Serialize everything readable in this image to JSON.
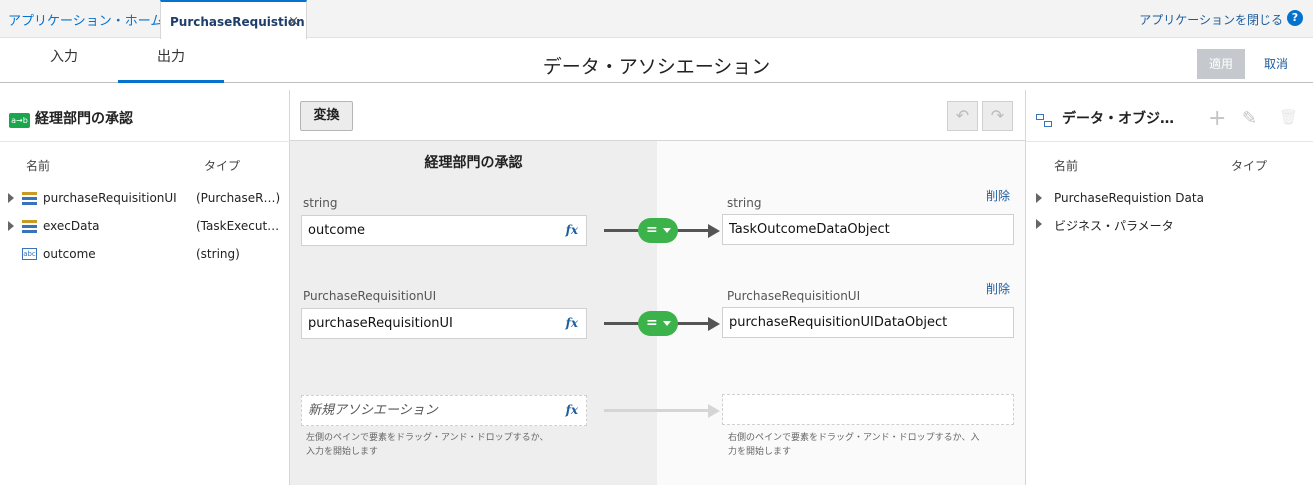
{
  "topbar": {
    "home_tab": "アプリケーション・ホーム",
    "active_tab": "PurchaseRequistion",
    "close_symbol": "×",
    "close_app": "アプリケーションを閉じる",
    "help": "?"
  },
  "header": {
    "tab_input": "入力",
    "tab_output": "出力",
    "title": "データ・アソシエーション",
    "apply": "適用",
    "cancel": "取消"
  },
  "left": {
    "title": "経理部門の承認",
    "icon_text": "a→b",
    "col_name": "名前",
    "col_type": "タイプ",
    "items": [
      {
        "label": "purchaseRequisitionUI",
        "type": "(PurchaseR…)",
        "icon": "list-icon",
        "expandable": true
      },
      {
        "label": "execData",
        "type": "(TaskExecut…)",
        "icon": "list-icon",
        "expandable": true
      },
      {
        "label": "outcome",
        "type": "(string)",
        "icon": "abc-icon",
        "expandable": false
      }
    ]
  },
  "middle": {
    "transform": "変換",
    "undo_icon": "↶",
    "redo_icon": "↷",
    "source_title": "経理部門の承認",
    "fx": "fx",
    "eq": "=",
    "delete": "削除",
    "mappings": [
      {
        "source_type": "string",
        "source_value": "outcome",
        "target_type": "string",
        "target_value": "TaskOutcomeDataObject"
      },
      {
        "source_type": "PurchaseRequisitionUI",
        "source_value": "purchaseRequisitionUI",
        "target_type": "PurchaseRequisitionUI",
        "target_value": "purchaseRequisitionUIDataObject"
      }
    ],
    "new_association": "新規アソシエーション",
    "hint_left_1": "左側のペインで要素をドラッグ・アンド・ドロップするか、",
    "hint_left_2": "入力を開始します",
    "hint_right_1": "右側のペインで要素をドラッグ・アンド・ドロップするか、入",
    "hint_right_2": "力を開始します"
  },
  "right": {
    "title": "データ・オブジ…",
    "add_icon": "+",
    "edit_icon": "✎",
    "delete_icon": "🗑",
    "col_name": "名前",
    "col_type": "タイプ",
    "items": [
      {
        "label": "PurchaseRequistion Data"
      },
      {
        "label": "ビジネス・パラメータ"
      }
    ]
  },
  "colors": {
    "accent": "#0572ce",
    "link": "#1d5c9e",
    "eq_green": "#3cb24b",
    "apply_disabled": "#c5c9cd"
  }
}
